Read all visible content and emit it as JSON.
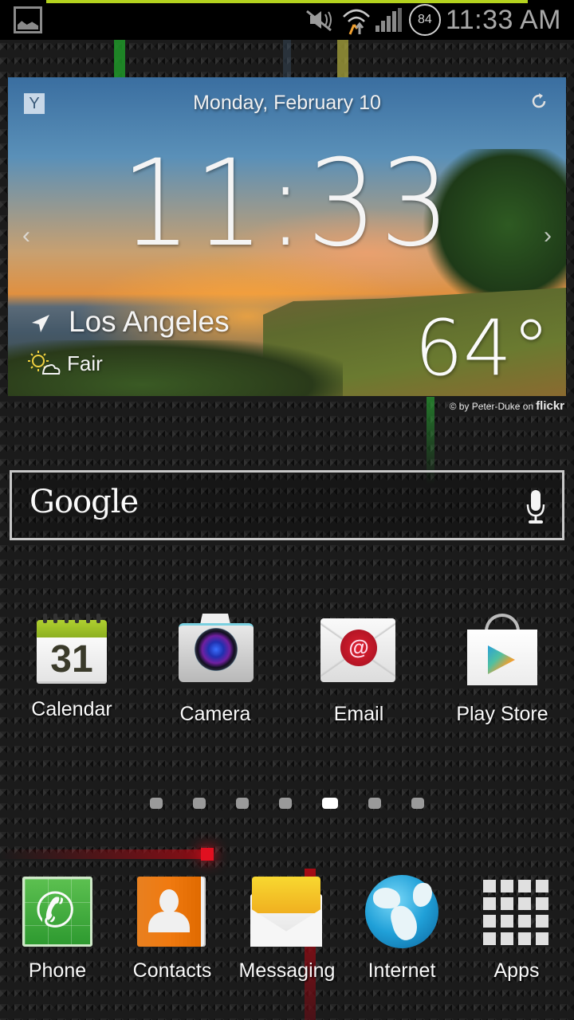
{
  "status_bar": {
    "notification_icon": "gallery-icon",
    "icons": [
      "mute-icon",
      "wifi-icon",
      "signal-icon"
    ],
    "battery_level": "84",
    "time": "11:33 AM",
    "accent_color": "#b4d21e"
  },
  "weather_widget": {
    "provider_icon": "Y",
    "date": "Monday, February 10",
    "time": "11:33",
    "city": "Los Angeles",
    "condition": "Fair",
    "temperature": "64°",
    "photo_credit_prefix": "© by Peter-Duke on",
    "photo_credit_source": "flickr",
    "prev_label": "‹",
    "next_label": "›"
  },
  "google_search": {
    "logo_text": "Google",
    "mic_icon": "microphone-icon"
  },
  "home_apps": [
    {
      "label": "Calendar",
      "icon": "calendar-icon",
      "calendar_day": "31"
    },
    {
      "label": "Camera",
      "icon": "camera-icon"
    },
    {
      "label": "Email",
      "icon": "email-icon",
      "glyph": "@"
    },
    {
      "label": "Play Store",
      "icon": "play-store-icon"
    }
  ],
  "pager": {
    "total_pages": 7,
    "active_page": 5
  },
  "dock": [
    {
      "label": "Phone",
      "icon": "phone-icon",
      "glyph": "✆"
    },
    {
      "label": "Contacts",
      "icon": "contacts-icon"
    },
    {
      "label": "Messaging",
      "icon": "messaging-icon"
    },
    {
      "label": "Internet",
      "icon": "globe-icon"
    },
    {
      "label": "Apps",
      "icon": "apps-grid-icon"
    }
  ]
}
